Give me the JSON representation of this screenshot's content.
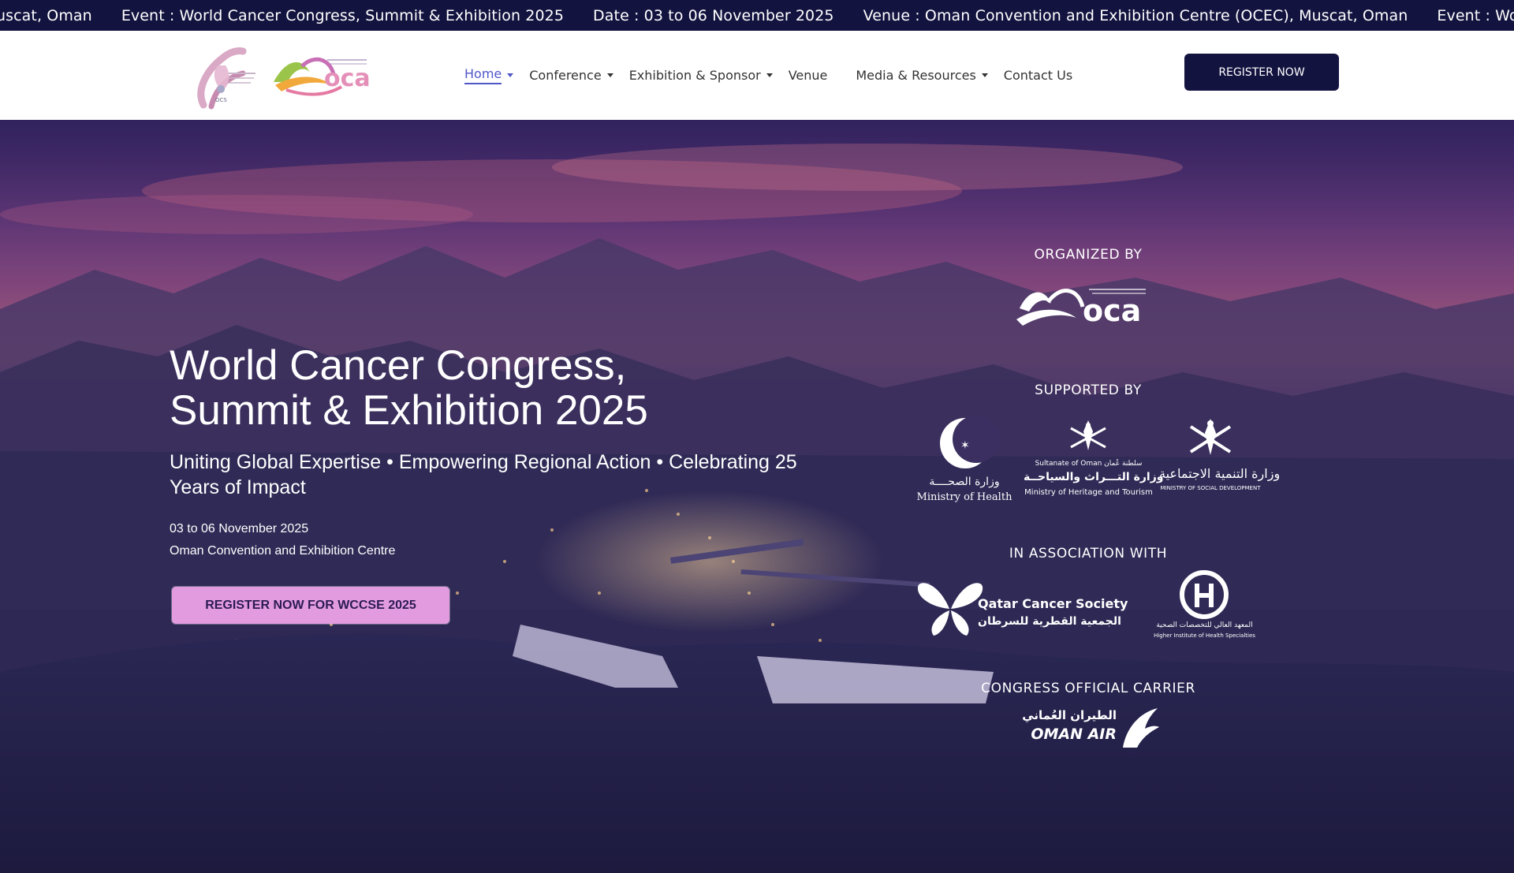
{
  "ticker": {
    "items": [
      "uscat, Oman",
      "Event : World Cancer Congress, Summit & Exhibition 2025",
      "Date : 03 to 06 November 2025",
      "Venue : Oman Convention and Exhibition Centre (OCEC), Muscat, Oman",
      "Event : Wo"
    ]
  },
  "header": {
    "nav": [
      {
        "label": "Home",
        "has_dropdown": true,
        "active": true
      },
      {
        "label": "Conference",
        "has_dropdown": true,
        "active": false
      },
      {
        "label": "Exhibition & Sponsor",
        "has_dropdown": true,
        "active": false
      },
      {
        "label": "Venue",
        "has_dropdown": false,
        "active": false
      },
      {
        "label": "Media & Resources",
        "has_dropdown": true,
        "active": false
      },
      {
        "label": "Contact Us",
        "has_dropdown": false,
        "active": false
      }
    ],
    "register_label": "REGISTER NOW"
  },
  "hero": {
    "title_line1": "World Cancer Congress,",
    "title_line2": "Summit & Exhibition 2025",
    "subtitle": "Uniting Global Expertise • Empowering Regional Action • Celebrating 25 Years of Impact",
    "date": "03 to 06 November 2025",
    "venue": "Oman Convention and Exhibition Centre",
    "cta_label": "REGISTER NOW FOR WCCSE 2025"
  },
  "partners": {
    "organized_by": "ORGANIZED BY",
    "supported_by": "SUPPORTED BY",
    "in_association": "IN ASSOCIATION WITH",
    "official_carrier": "CONGRESS OFFICIAL CARRIER",
    "supporters": [
      {
        "name": "Ministry of Health",
        "arabic": "وزارة الصحــــة"
      },
      {
        "name": "Ministry of Heritage and Tourism",
        "arabic": "وزارة التـــراث والسياحــة",
        "prefix": "Sultanate of Oman  سلطنة عُمان"
      },
      {
        "name": "MINISTRY OF SOCIAL DEVELOPMENT",
        "arabic": "وزارة التنمية الاجتماعية"
      }
    ],
    "associates": [
      {
        "name": "Qatar Cancer Society",
        "arabic": "الجمعية القطرية للسرطان"
      },
      {
        "name": "Higher Institute of Health Specialties",
        "arabic": "المعهد العالي للتخصصات الصحية"
      }
    ],
    "carrier": {
      "name": "OMAN AIR",
      "arabic": "الطيران العُماني"
    }
  },
  "colors": {
    "navy": "#131340",
    "nav_active": "#4f57c8",
    "cta_pink": "#e39be0"
  }
}
